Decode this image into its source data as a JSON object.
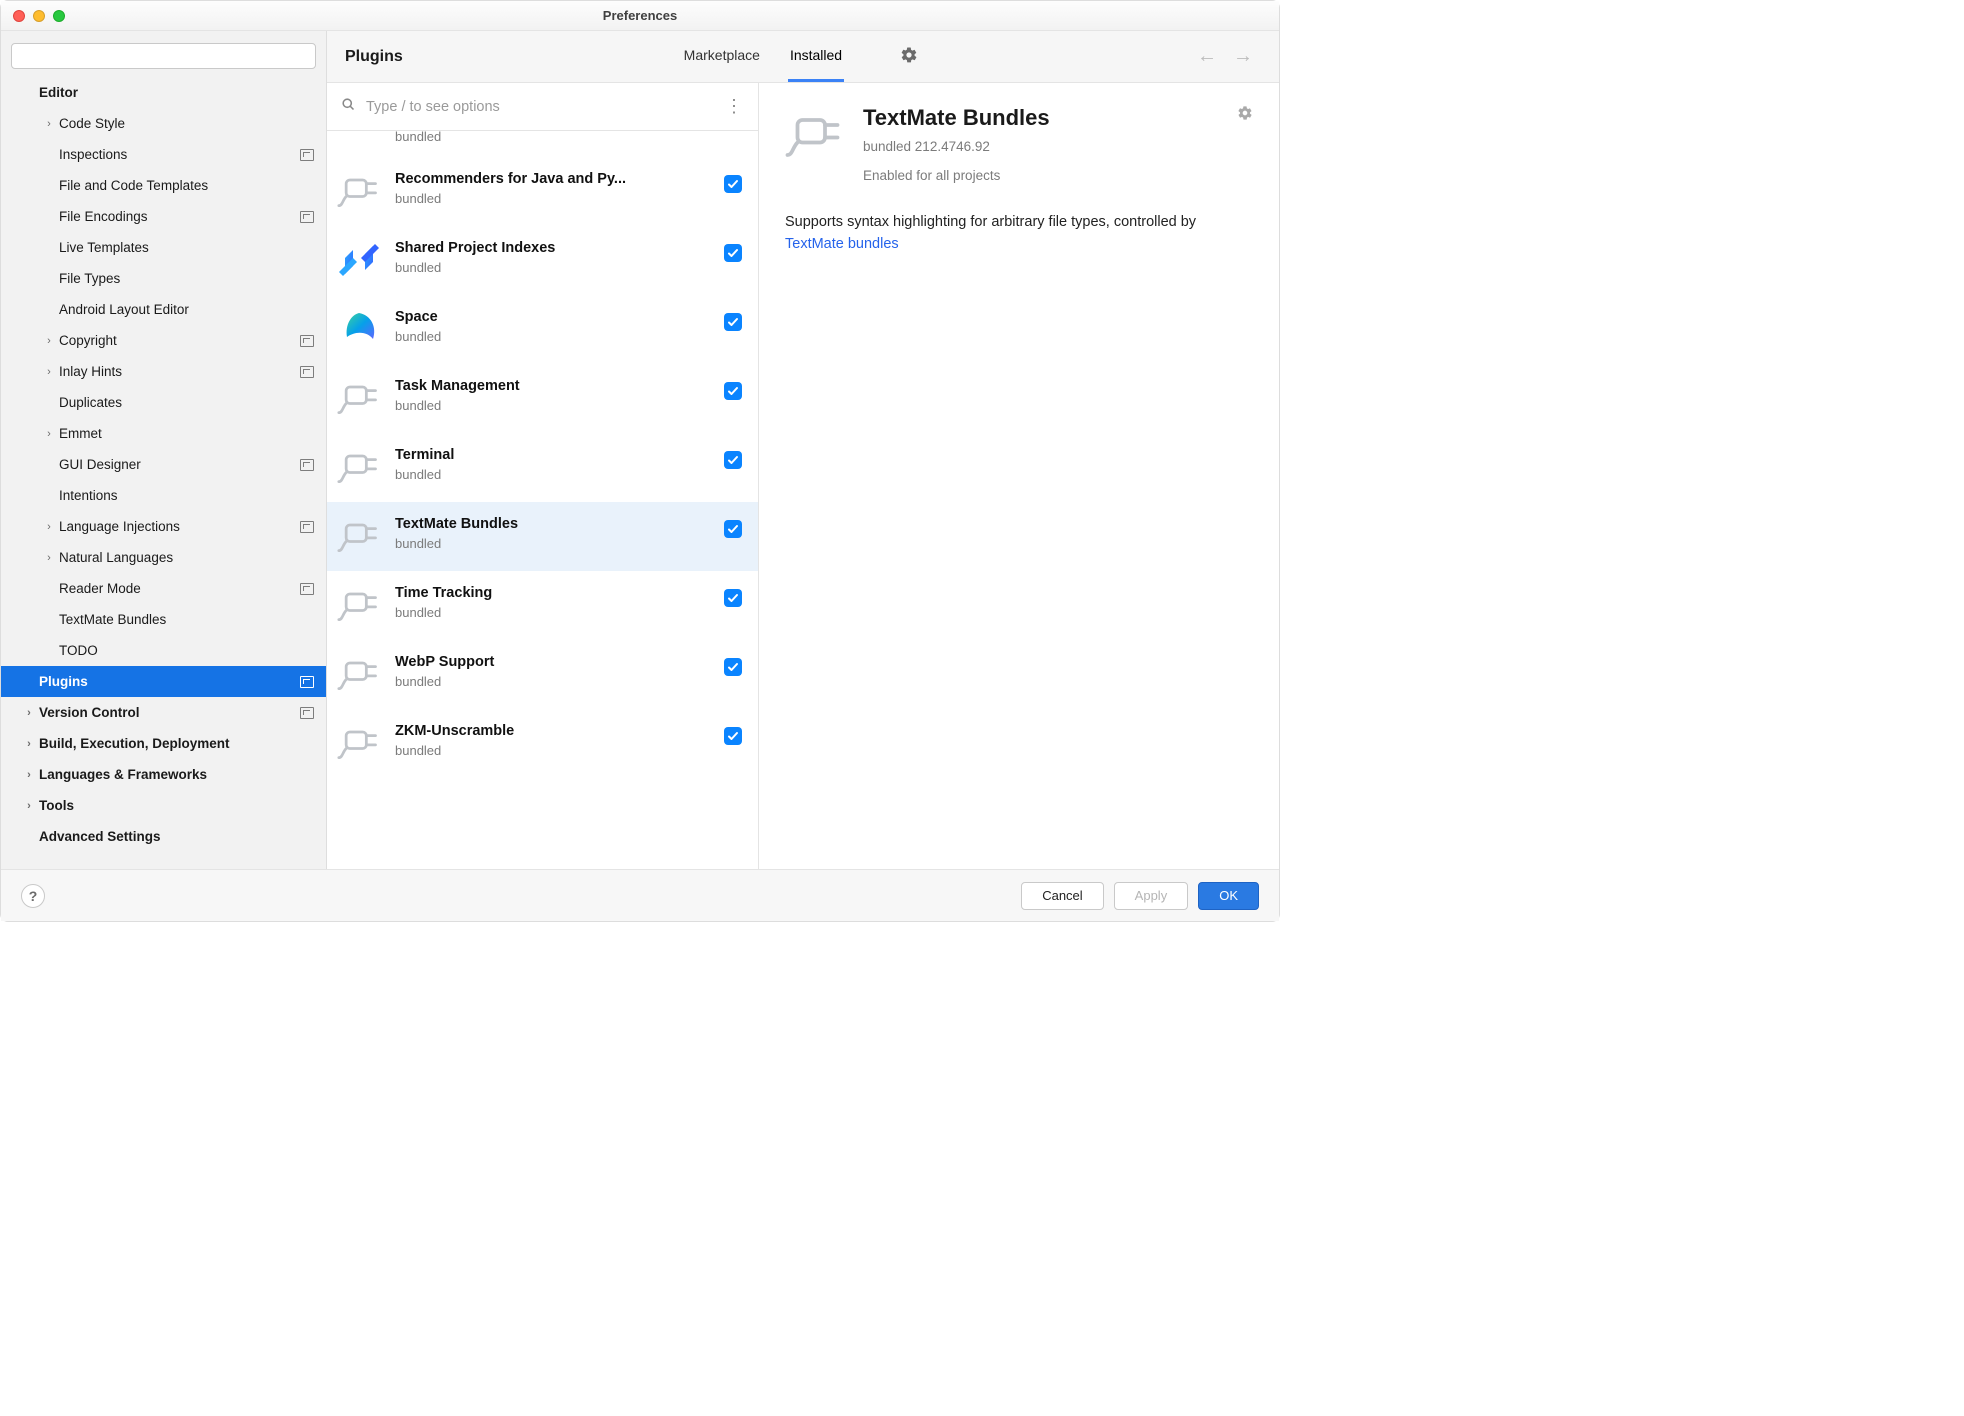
{
  "window": {
    "title": "Preferences"
  },
  "sidebar": {
    "search_placeholder": "",
    "items": [
      {
        "label": "Editor",
        "indent": 0,
        "bold": true,
        "arrow": false,
        "scope": false
      },
      {
        "label": "Code Style",
        "indent": 1,
        "bold": false,
        "arrow": true,
        "scope": false
      },
      {
        "label": "Inspections",
        "indent": 1,
        "bold": false,
        "arrow": false,
        "scope": true
      },
      {
        "label": "File and Code Templates",
        "indent": 1,
        "bold": false,
        "arrow": false,
        "scope": false
      },
      {
        "label": "File Encodings",
        "indent": 1,
        "bold": false,
        "arrow": false,
        "scope": true
      },
      {
        "label": "Live Templates",
        "indent": 1,
        "bold": false,
        "arrow": false,
        "scope": false
      },
      {
        "label": "File Types",
        "indent": 1,
        "bold": false,
        "arrow": false,
        "scope": false
      },
      {
        "label": "Android Layout Editor",
        "indent": 1,
        "bold": false,
        "arrow": false,
        "scope": false
      },
      {
        "label": "Copyright",
        "indent": 1,
        "bold": false,
        "arrow": true,
        "scope": true
      },
      {
        "label": "Inlay Hints",
        "indent": 1,
        "bold": false,
        "arrow": true,
        "scope": true
      },
      {
        "label": "Duplicates",
        "indent": 1,
        "bold": false,
        "arrow": false,
        "scope": false
      },
      {
        "label": "Emmet",
        "indent": 1,
        "bold": false,
        "arrow": true,
        "scope": false
      },
      {
        "label": "GUI Designer",
        "indent": 1,
        "bold": false,
        "arrow": false,
        "scope": true
      },
      {
        "label": "Intentions",
        "indent": 1,
        "bold": false,
        "arrow": false,
        "scope": false
      },
      {
        "label": "Language Injections",
        "indent": 1,
        "bold": false,
        "arrow": true,
        "scope": true
      },
      {
        "label": "Natural Languages",
        "indent": 1,
        "bold": false,
        "arrow": true,
        "scope": false
      },
      {
        "label": "Reader Mode",
        "indent": 1,
        "bold": false,
        "arrow": false,
        "scope": true
      },
      {
        "label": "TextMate Bundles",
        "indent": 1,
        "bold": false,
        "arrow": false,
        "scope": false
      },
      {
        "label": "TODO",
        "indent": 1,
        "bold": false,
        "arrow": false,
        "scope": false
      },
      {
        "label": "Plugins",
        "indent": 0,
        "bold": true,
        "arrow": false,
        "scope": true,
        "selected": true
      },
      {
        "label": "Version Control",
        "indent": 0,
        "bold": true,
        "arrow": true,
        "scope": true
      },
      {
        "label": "Build, Execution, Deployment",
        "indent": 0,
        "bold": true,
        "arrow": true,
        "scope": false
      },
      {
        "label": "Languages & Frameworks",
        "indent": 0,
        "bold": true,
        "arrow": true,
        "scope": false
      },
      {
        "label": "Tools",
        "indent": 0,
        "bold": true,
        "arrow": true,
        "scope": false
      },
      {
        "label": "Advanced Settings",
        "indent": 0,
        "bold": true,
        "arrow": false,
        "scope": false
      }
    ]
  },
  "plugins": {
    "title": "Plugins",
    "tabs": {
      "marketplace": "Marketplace",
      "installed": "Installed"
    },
    "filter_placeholder": "Type / to see options",
    "list": [
      {
        "name": "Recommenders for Java and Py...",
        "sub": "bundled",
        "icon": "plug",
        "enabled": true
      },
      {
        "name": "Shared Project Indexes",
        "sub": "bundled",
        "icon": "shared",
        "enabled": true
      },
      {
        "name": "Space",
        "sub": "bundled",
        "icon": "space",
        "enabled": true
      },
      {
        "name": "Task Management",
        "sub": "bundled",
        "icon": "plug",
        "enabled": true
      },
      {
        "name": "Terminal",
        "sub": "bundled",
        "icon": "plug",
        "enabled": true
      },
      {
        "name": "TextMate Bundles",
        "sub": "bundled",
        "icon": "plug",
        "enabled": true,
        "selected": true
      },
      {
        "name": "Time Tracking",
        "sub": "bundled",
        "icon": "plug",
        "enabled": true
      },
      {
        "name": "WebP Support",
        "sub": "bundled",
        "icon": "plug",
        "enabled": true
      },
      {
        "name": "ZKM-Unscramble",
        "sub": "bundled",
        "icon": "plug",
        "enabled": true
      }
    ],
    "partial_top_sub": "bundled"
  },
  "detail": {
    "title": "TextMate Bundles",
    "version": "bundled 212.4746.92",
    "enabled_text": "Enabled for all projects",
    "description_prefix": "Supports syntax highlighting for arbitrary file types, controlled by ",
    "description_link": "TextMate bundles"
  },
  "footer": {
    "cancel": "Cancel",
    "apply": "Apply",
    "ok": "OK"
  }
}
